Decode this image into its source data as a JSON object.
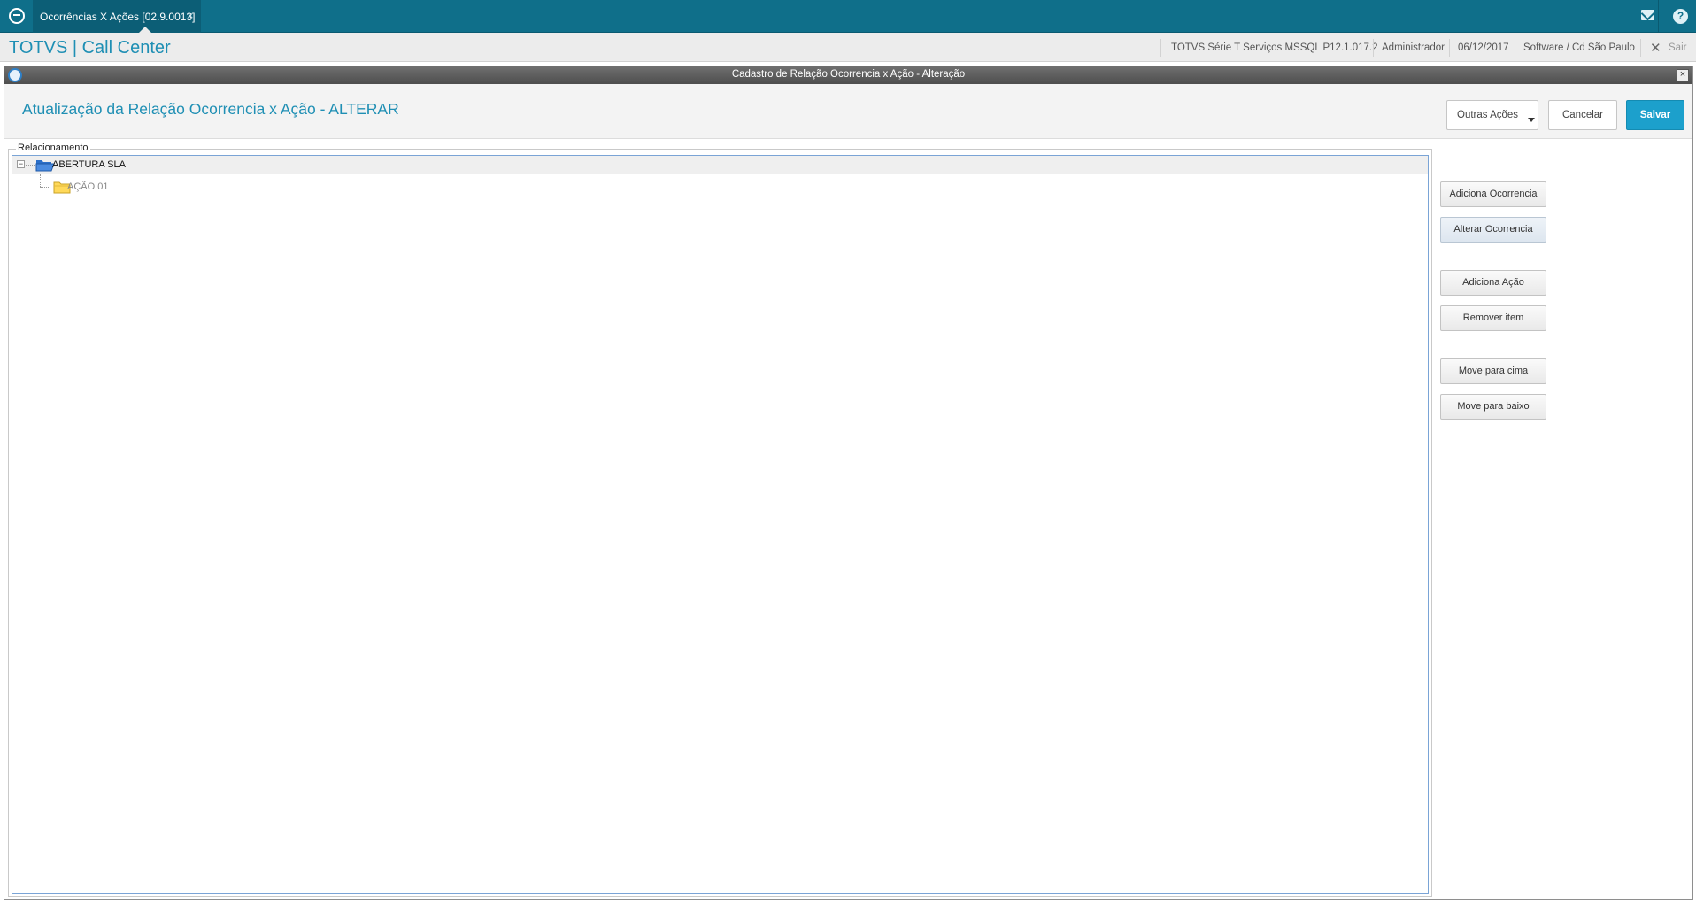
{
  "topbar": {
    "tab_label": "Ocorrências X Ações [02.9.0013]",
    "tab_close": "×",
    "mail_icon": "mail-icon",
    "help_icon": "?"
  },
  "header": {
    "brand": "TOTVS | Call Center",
    "system": "TOTVS Série T Serviços MSSQL P12.1.017.2",
    "user": "Administrador",
    "date": "06/12/2017",
    "company": "Software / Cd São Paulo",
    "exit_icon": "✕",
    "exit_label": "Sair"
  },
  "dialog": {
    "title": "Cadastro de Relação Ocorrencia x Ação - Alteração",
    "close": "×",
    "page_title": "Atualização da Relação Ocorrencia x Ação - ALTERAR",
    "buttons": {
      "other": "Outras Ações",
      "cancel": "Cancelar",
      "save": "Salvar"
    },
    "group_label": "Relacionamento",
    "tree": {
      "expander": "−",
      "root": "ABERTURA SLA",
      "child": "AÇÃO 01"
    },
    "side_buttons": {
      "add_occurrence": "Adiciona Ocorrencia",
      "edit_occurrence": "Alterar Ocorrencia",
      "add_action": "Adiciona Ação",
      "remove_item": "Remover item",
      "move_up": "Move para cima",
      "move_down": "Move para baixo"
    }
  },
  "colors": {
    "topbar": "#0f6f8a",
    "accent": "#1f8fb4",
    "save_button": "#1ca0cc"
  }
}
